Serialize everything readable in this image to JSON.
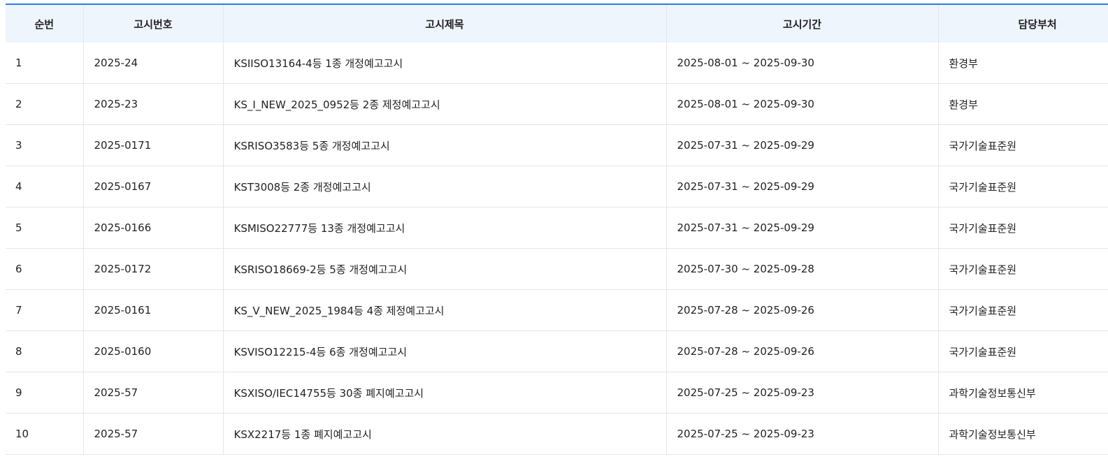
{
  "columns": [
    "순번",
    "고시번호",
    "고시제목",
    "고시기간",
    "담당부처"
  ],
  "rows": [
    {
      "no": "1",
      "code": "2025-24",
      "title": "KSIISO13164-4등 1종 개정예고고시",
      "period": "2025-08-01 ~ 2025-09-30",
      "dept": "환경부"
    },
    {
      "no": "2",
      "code": "2025-23",
      "title": "KS_I_NEW_2025_0952등 2종 제정예고고시",
      "period": "2025-08-01 ~ 2025-09-30",
      "dept": "환경부"
    },
    {
      "no": "3",
      "code": "2025-0171",
      "title": "KSRISO3583등 5종 개정예고고시",
      "period": "2025-07-31 ~ 2025-09-29",
      "dept": "국가기술표준원"
    },
    {
      "no": "4",
      "code": "2025-0167",
      "title": "KST3008등 2종 개정예고고시",
      "period": "2025-07-31 ~ 2025-09-29",
      "dept": "국가기술표준원"
    },
    {
      "no": "5",
      "code": "2025-0166",
      "title": "KSMISO22777등 13종 개정예고고시",
      "period": "2025-07-31 ~ 2025-09-29",
      "dept": "국가기술표준원"
    },
    {
      "no": "6",
      "code": "2025-0172",
      "title": "KSRISO18669-2등 5종 개정예고고시",
      "period": "2025-07-30 ~ 2025-09-28",
      "dept": "국가기술표준원"
    },
    {
      "no": "7",
      "code": "2025-0161",
      "title": "KS_V_NEW_2025_1984등 4종 제정예고고시",
      "period": "2025-07-28 ~ 2025-09-26",
      "dept": "국가기술표준원"
    },
    {
      "no": "8",
      "code": "2025-0160",
      "title": "KSVISO12215-4등 6종 개정예고고시",
      "period": "2025-07-28 ~ 2025-09-26",
      "dept": "국가기술표준원"
    },
    {
      "no": "9",
      "code": "2025-57",
      "title": "KSXISO/IEC14755등 30종 폐지예고고시",
      "period": "2025-07-25 ~ 2025-09-23",
      "dept": "과학기술정보통신부"
    },
    {
      "no": "10",
      "code": "2025-57",
      "title": "KSX2217등 1종 폐지예고고시",
      "period": "2025-07-25 ~ 2025-09-23",
      "dept": "과학기술정보통신부"
    }
  ],
  "colors": {
    "header_bg": "#eef5fc",
    "top_border": "#2a7de1",
    "row_border": "#e6e6e6"
  }
}
